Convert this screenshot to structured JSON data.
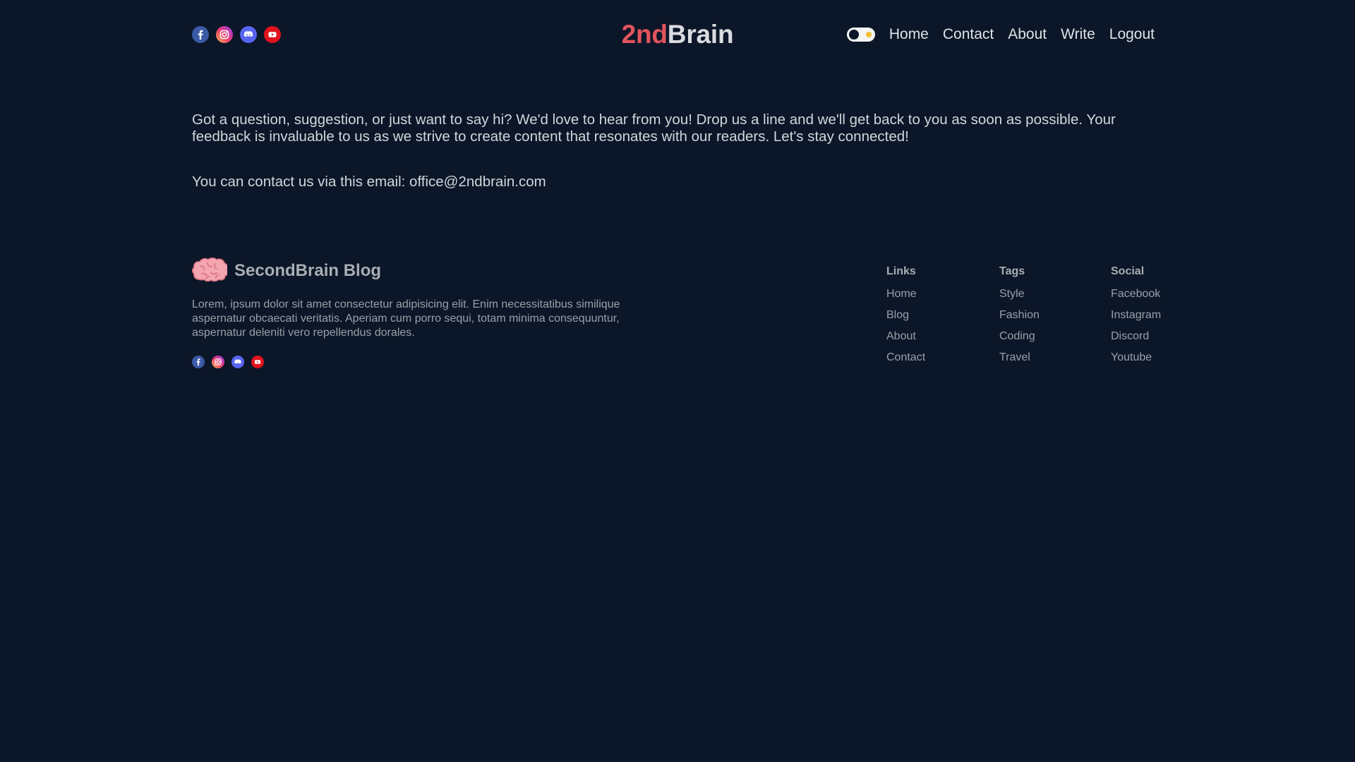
{
  "header": {
    "logo_accent": "2nd",
    "logo_rest": "Brain",
    "social": [
      "facebook-icon",
      "instagram-icon",
      "discord-icon",
      "youtube-icon"
    ],
    "nav": {
      "home": "Home",
      "contact": "Contact",
      "about": "About",
      "write": "Write",
      "logout": "Logout"
    }
  },
  "main": {
    "intro": "Got a question, suggestion, or just want to say hi? We'd love to hear from you! Drop us a line and we'll get back to you as soon as possible. Your feedback is invaluable to us as we strive to create content that resonates with our readers. Let's stay connected!",
    "email_line": "You can contact us via this email: office@2ndbrain.com"
  },
  "footer": {
    "brand_name": "SecondBrain Blog",
    "description": "Lorem, ipsum dolor sit amet consectetur adipisicing elit. Enim necessitatibus similique aspernatur obcaecati veritatis. Aperiam cum porro sequi, totam minima consequuntur, aspernatur deleniti vero repellendus dorales.",
    "columns": [
      {
        "title": "Links",
        "items": [
          "Home",
          "Blog",
          "About",
          "Contact"
        ]
      },
      {
        "title": "Tags",
        "items": [
          "Style",
          "Fashion",
          "Coding",
          "Travel"
        ]
      },
      {
        "title": "Social",
        "items": [
          "Facebook",
          "Instagram",
          "Discord",
          "Youtube"
        ]
      }
    ]
  },
  "colors": {
    "background": "#0b1628",
    "logo_accent": "#e2545c",
    "text": "#d6d9de",
    "muted": "#9aa0a8"
  }
}
